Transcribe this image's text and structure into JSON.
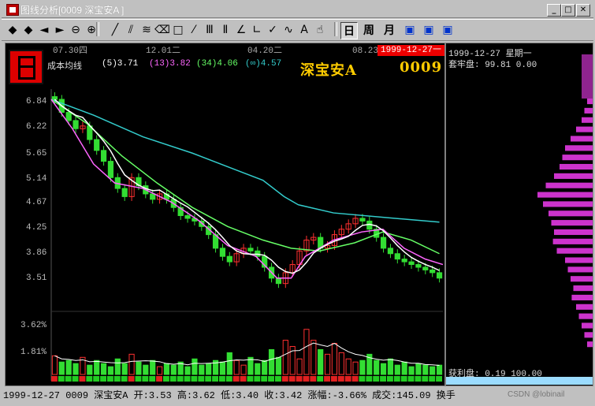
{
  "window": {
    "title": "图线分析[0009 深宝安A ]",
    "controls": [
      "_",
      "□",
      "✕"
    ]
  },
  "toolbar": {
    "tools": [
      {
        "name": "zoom-in-icon",
        "glyph": "◆"
      },
      {
        "name": "zoom-out-icon",
        "glyph": "◆"
      },
      {
        "name": "move-left-icon",
        "glyph": "◄"
      },
      {
        "name": "move-right-icon",
        "glyph": "►"
      },
      {
        "name": "magnify-minus-icon",
        "glyph": "⊖"
      },
      {
        "name": "magnify-plus-icon",
        "glyph": "⊕"
      },
      {
        "name": "line-tool-icon",
        "glyph": "╱"
      },
      {
        "name": "parallel-line-icon",
        "glyph": "⫽"
      },
      {
        "name": "fan-line-icon",
        "glyph": "≋"
      },
      {
        "name": "eraser-icon",
        "glyph": "⌫"
      },
      {
        "name": "rectangle-icon",
        "glyph": "□"
      },
      {
        "name": "cross-line-icon",
        "glyph": "⁄"
      },
      {
        "name": "cycle-line-icon",
        "glyph": "Ⅲ"
      },
      {
        "name": "fibonacci-icon",
        "glyph": "Ⅱ"
      },
      {
        "name": "angle-line-icon",
        "glyph": "∠"
      },
      {
        "name": "arrow-line-icon",
        "glyph": "∟"
      },
      {
        "name": "check-line-icon",
        "glyph": "✓"
      },
      {
        "name": "wave-line-icon",
        "glyph": "∿"
      },
      {
        "name": "text-tool-icon",
        "glyph": "A"
      },
      {
        "name": "hand-icon",
        "glyph": "☝"
      }
    ],
    "periods": [
      {
        "name": "period-day-button",
        "label": "日",
        "pressed": true
      },
      {
        "name": "period-week-button",
        "label": "周",
        "pressed": false
      },
      {
        "name": "period-month-button",
        "label": "月",
        "pressed": false
      }
    ],
    "extra": [
      "window-a-icon",
      "window-b-icon",
      "window-c-icon"
    ]
  },
  "chart": {
    "dates_top": [
      "07.30四",
      "12.01二",
      "04.20二",
      "08.23一"
    ],
    "cursor_date": "1999-12-27一",
    "ma_title": "成本均线",
    "ma_items": [
      {
        "label": "(5)3.71",
        "color": "#ffffff"
      },
      {
        "label": "(13)3.82",
        "color": "#ff66ff"
      },
      {
        "label": "(34)4.06",
        "color": "#66ff66"
      },
      {
        "label": "(∞)4.57",
        "color": "#33cccc"
      }
    ],
    "stock_name": "深宝安A",
    "stock_code": "0009",
    "y_price_ticks": [
      "6.84",
      "6.22",
      "5.65",
      "5.14",
      "4.67",
      "4.25",
      "3.86",
      "3.51"
    ],
    "y_volume_ticks": [
      "3.62%",
      "1.81%"
    ]
  },
  "chart_data": {
    "type": "candlestick",
    "title": "深宝安A 0009",
    "ylim": [
      3.3,
      7.0
    ],
    "ma_lines": [
      {
        "name": "(5)",
        "color": "#ffffff"
      },
      {
        "name": "(13)",
        "color": "#ff66ff"
      },
      {
        "name": "(34)",
        "color": "#66ff66"
      },
      {
        "name": "(∞)",
        "color": "#33cccc"
      }
    ],
    "ma_infinity_points": [
      [
        0,
        6.84
      ],
      [
        60,
        6.55
      ],
      [
        130,
        6.15
      ],
      [
        200,
        5.85
      ],
      [
        260,
        5.55
      ],
      [
        300,
        5.35
      ],
      [
        330,
        5.05
      ],
      [
        350,
        4.9
      ],
      [
        400,
        4.75
      ],
      [
        470,
        4.67
      ],
      [
        550,
        4.58
      ]
    ],
    "ma_34_points": [
      [
        0,
        6.84
      ],
      [
        50,
        6.4
      ],
      [
        100,
        5.8
      ],
      [
        150,
        5.3
      ],
      [
        200,
        4.85
      ],
      [
        250,
        4.5
      ],
      [
        300,
        4.25
      ],
      [
        340,
        4.1
      ],
      [
        380,
        4.05
      ],
      [
        430,
        4.2
      ],
      [
        470,
        4.4
      ],
      [
        510,
        4.25
      ],
      [
        550,
        4.0
      ]
    ],
    "ma_13_points": [
      [
        0,
        6.84
      ],
      [
        30,
        6.3
      ],
      [
        60,
        5.65
      ],
      [
        90,
        5.3
      ],
      [
        130,
        5.2
      ],
      [
        170,
        4.95
      ],
      [
        210,
        4.6
      ],
      [
        250,
        4.15
      ],
      [
        290,
        3.95
      ],
      [
        320,
        3.55
      ],
      [
        340,
        3.55
      ],
      [
        360,
        3.95
      ],
      [
        400,
        4.25
      ],
      [
        440,
        4.4
      ],
      [
        470,
        4.45
      ],
      [
        500,
        4.1
      ],
      [
        530,
        3.9
      ],
      [
        555,
        3.8
      ]
    ],
    "price_series": [
      6.84,
      6.6,
      6.45,
      6.3,
      6.35,
      6.1,
      5.9,
      5.7,
      5.4,
      5.2,
      5.05,
      5.4,
      5.25,
      5.1,
      5.0,
      5.1,
      5.0,
      4.85,
      4.7,
      4.65,
      4.6,
      4.5,
      4.35,
      4.1,
      3.95,
      3.85,
      4.0,
      4.1,
      4.05,
      3.95,
      3.75,
      3.55,
      3.45,
      3.65,
      3.8,
      4.05,
      4.25,
      4.3,
      4.1,
      4.15,
      4.35,
      4.45,
      4.55,
      4.65,
      4.6,
      4.45,
      4.3,
      4.1,
      4.0,
      3.9,
      3.85,
      3.8,
      3.75,
      3.7,
      3.65,
      3.55
    ],
    "volume_pct": [
      1.2,
      0.8,
      0.9,
      0.7,
      1.1,
      0.6,
      0.9,
      0.7,
      0.5,
      1.0,
      0.7,
      1.3,
      0.8,
      0.6,
      0.9,
      0.5,
      0.7,
      0.6,
      0.8,
      0.5,
      1.0,
      0.6,
      0.7,
      0.9,
      0.8,
      1.4,
      0.9,
      0.6,
      1.1,
      0.7,
      0.9,
      1.6,
      1.1,
      2.2,
      1.8,
      1.0,
      2.9,
      2.2,
      1.6,
      1.3,
      2.0,
      1.4,
      1.0,
      0.8,
      0.9,
      1.3,
      0.9,
      0.7,
      1.0,
      0.6,
      0.8,
      0.5,
      0.7,
      0.6,
      0.5,
      0.6
    ],
    "chip_distribution_levels": [
      0.1,
      0.15,
      0.2,
      0.3,
      0.4,
      0.5,
      0.55,
      0.6,
      0.7,
      0.85,
      1.0,
      0.9,
      0.8,
      0.75,
      0.7,
      0.72,
      0.65,
      0.5,
      0.45,
      0.4,
      0.35,
      0.38,
      0.3,
      0.25,
      0.2,
      0.15,
      0.1
    ]
  },
  "side": {
    "date": "1999-12-27 星期一",
    "chip_label": "套牢盘: 99.81 0.00",
    "profit_label": "获利盘: 0.19 100.00"
  },
  "status": {
    "date": "1999-12-27",
    "code": "0009",
    "name": "深宝安A",
    "open_label": "开:",
    "open": "3.53",
    "high_label": "高:",
    "high": "3.62",
    "low_label": "低:",
    "low": "3.40",
    "close_label": "收:",
    "close": "3.42",
    "change_label": "涨幅:",
    "change": "-3.66%",
    "volume_label": "成交:",
    "volume": "145.09",
    "turnover_label": "换手"
  },
  "watermark": "CSDN @lobinail"
}
